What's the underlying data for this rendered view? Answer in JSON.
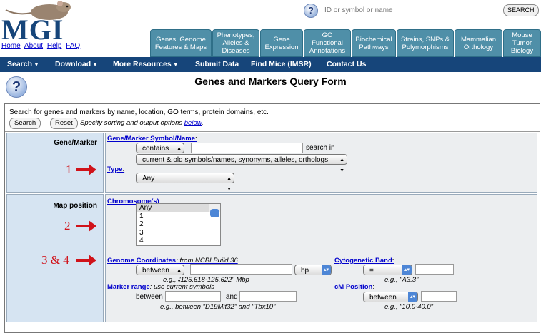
{
  "header": {
    "logo": "MGI",
    "links": [
      "Home",
      "About",
      "Help",
      "FAQ"
    ],
    "search_placeholder": "ID or symbol or name",
    "search_button": "SEARCH",
    "help_icon": "?",
    "tabs": [
      "Genes, Genome\nFeatures & Maps",
      "Phenotypes,\nAlleles &\nDiseases",
      "Gene\nExpression",
      "GO\nFunctional\nAnnotations",
      "Biochemical\nPathways",
      "Strains, SNPs &\nPolymorphisms",
      "Mammalian\nOrthology",
      "Mouse\nTumor\nBiology"
    ]
  },
  "nav": {
    "items": [
      "Search",
      "Download",
      "More Resources",
      "Submit Data",
      "Find Mice (IMSR)",
      "Contact Us"
    ],
    "caret": "▼"
  },
  "page": {
    "title": "Genes and Markers Query Form",
    "help_icon": "?"
  },
  "intro": {
    "text": "Search for genes and markers by name, location, GO terms, protein domains, etc.",
    "search_button": "Search",
    "reset_button": "Reset",
    "hint_prefix": "Specify sorting and output options",
    "hint_link": "below",
    "hint_suffix": "."
  },
  "gene_marker": {
    "label": "Gene/Marker",
    "field_link": "Gene/Marker Symbol/Name",
    "field_colon": ":",
    "operator": "contains",
    "search_in_label": "search in",
    "search_in_value": "current & old symbols/names, synonyms, alleles, orthologs",
    "type_link": "Type",
    "type_colon": ":",
    "type_value": "Any"
  },
  "map_position": {
    "label": "Map position",
    "chromosome_link": "Chromosome(s)",
    "chromosome_colon": ":",
    "chromosome_options": [
      "Any",
      "1",
      "2",
      "3",
      "4"
    ],
    "chromosome_selected": "Any",
    "genome_link": "Genome Coordinates",
    "genome_note": ": from NCBI Build 36",
    "genome_operator": "between",
    "genome_unit": "bp",
    "genome_example": "e.g., \"125.618-125.622\" Mbp",
    "cyto_link": "Cytogenetic Band",
    "cyto_colon": ":",
    "cyto_operator": "=",
    "cyto_example": "e.g., \"A3.3\"",
    "marker_range_link": "Marker range",
    "marker_range_note": ": use current symbols",
    "between_label": "between",
    "and_label": "and",
    "marker_range_example": "e.g., between \"D19Mit32\" and \"Tbx10\"",
    "cm_link": "cM Position",
    "cm_colon": ":",
    "cm_operator": "between",
    "cm_example": "e.g., \"10.0-40.0\""
  },
  "annotations": [
    "1",
    "2",
    "3 & 4"
  ],
  "colors": {
    "navbar": "#16457a",
    "tab": "#4f8fa8",
    "label_cell": "#d6e4f2",
    "annotation": "#d0121a"
  }
}
